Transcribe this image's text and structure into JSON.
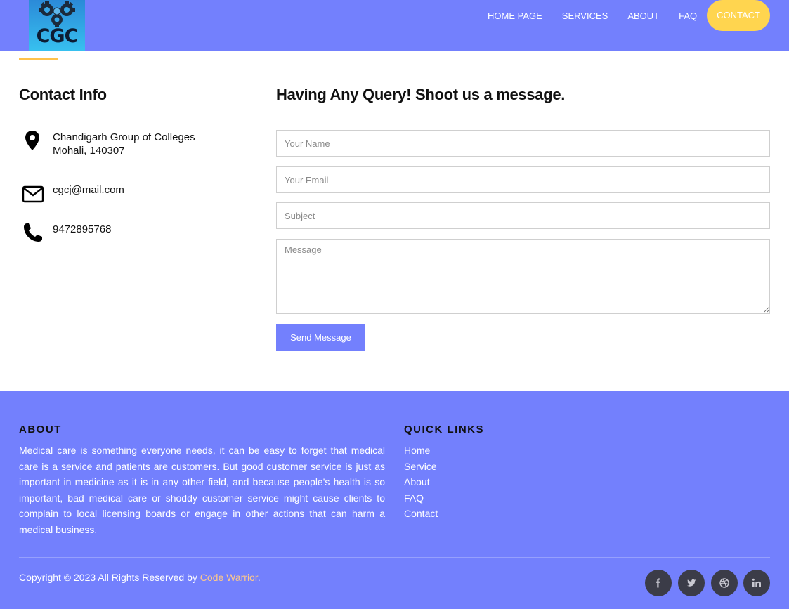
{
  "header": {
    "logo_text": "CGC",
    "nav": [
      {
        "label": "HOME PAGE"
      },
      {
        "label": "SERVICES"
      },
      {
        "label": "ABOUT"
      },
      {
        "label": "FAQ"
      },
      {
        "label": "CONTACT",
        "active": true
      }
    ]
  },
  "contact_info": {
    "title": "Contact Info",
    "address_line1": "Chandigarh Group of Colleges",
    "address_line2": "Mohali, 140307",
    "email": "cgcj@mail.com",
    "phone": "9472895768",
    "icons": [
      "map-pin-icon",
      "envelope-icon",
      "phone-icon"
    ]
  },
  "form": {
    "title": "Having Any Query! Shoot us a message.",
    "name_placeholder": "Your Name",
    "email_placeholder": "Your Email",
    "subject_placeholder": "Subject",
    "message_placeholder": "Message",
    "submit_label": "Send Message"
  },
  "footer": {
    "about_heading": "ABOUT",
    "about_text": "Medical care is something everyone needs, it can be easy to forget that medical care is a service and patients are customers. But good customer service is just as important in medicine as it is in any other field, and because people's health is so important, bad medical care or shoddy customer service might cause clients to complain to local licensing boards or engage in other actions that can harm a medical business.",
    "links_heading": "QUICK LINKS",
    "links": [
      "Home",
      "Service",
      "About",
      "FAQ",
      "Contact"
    ],
    "copyright_prefix": "Copyright © 2023 All Rights Reserved by ",
    "copyright_author": "Code Warrior",
    "copyright_suffix": ".",
    "social_icons": [
      "facebook-icon",
      "twitter-icon",
      "dribbble-icon",
      "linkedin-icon"
    ]
  },
  "colors": {
    "brand": "#7380fd",
    "accent": "#ffd54f",
    "author_link": "#ffc98a",
    "social_bg": "#3b3c48"
  }
}
